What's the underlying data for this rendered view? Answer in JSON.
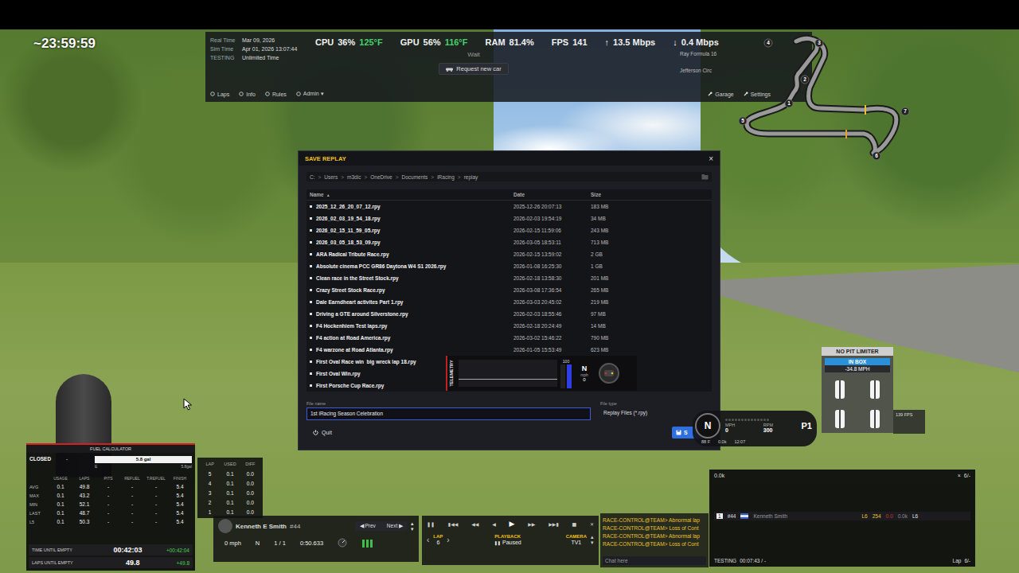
{
  "session_timer": "~23:59:59",
  "top_bar": {
    "info": [
      {
        "label": "Real Time",
        "value": "Mar 09, 2026"
      },
      {
        "label": "Sim Time",
        "value": "Apr 01, 2026 13:07:44"
      },
      {
        "label": "TESTING",
        "value": "Unlimited Time"
      }
    ],
    "stats": [
      {
        "label": "CPU",
        "value": "36%",
        "temp": "125°F"
      },
      {
        "label": "GPU",
        "value": "56%",
        "temp": "116°F"
      },
      {
        "label": "RAM",
        "value": "81.4%",
        "temp": ""
      },
      {
        "label": "FPS",
        "value": "141",
        "temp": ""
      },
      {
        "label": "↑",
        "value": "13.5 Mbps",
        "temp": ""
      },
      {
        "label": "↓",
        "value": "0.4 Mbps",
        "temp": ""
      }
    ],
    "status": "Wait",
    "request_button": "Request new car",
    "car": "Ray Formula 16",
    "track": "Jefferson Circ",
    "nav_left": [
      "Laps",
      "Info",
      "Rules",
      "Admin ▾"
    ],
    "nav_right": [
      "Garage",
      "Settings"
    ]
  },
  "track_map": {
    "turns": [
      "1",
      "2",
      "3",
      "4",
      "5",
      "6",
      "7"
    ]
  },
  "dialog": {
    "title": "SAVE REPLAY",
    "close": "×",
    "path": [
      "C:",
      "Users",
      "m3dic",
      "OneDrive",
      "Documents",
      "iRacing",
      "replay"
    ],
    "path_separator": ">",
    "columns": [
      {
        "label": "Name",
        "sort": "▲"
      },
      {
        "label": "Date",
        "sort": ""
      },
      {
        "label": "Size",
        "sort": ""
      }
    ],
    "rows": [
      {
        "name": "2025_12_26_20_07_12.rpy",
        "date": "2025-12-26 20:07:13",
        "size": "183 MB"
      },
      {
        "name": "2026_02_03_19_54_18.rpy",
        "date": "2026-02-03 19:54:19",
        "size": "34 MB"
      },
      {
        "name": "2026_02_15_11_59_05.rpy",
        "date": "2026-02-15 11:59:06",
        "size": "243 MB"
      },
      {
        "name": "2026_03_05_18_53_09.rpy",
        "date": "2026-03-05 18:53:11",
        "size": "713 MB"
      },
      {
        "name": "ARA Radical Tribute Race.rpy",
        "date": "2026-02-15 13:59:02",
        "size": "2 GB"
      },
      {
        "name": "Absolute cinema PCC GR86 Daytona W4 S1 2026.rpy",
        "date": "2026-01-08 16:25:30",
        "size": "1 GB"
      },
      {
        "name": "Clean race in the Street Stock.rpy",
        "date": "2026-02-18 13:58:30",
        "size": "201 MB"
      },
      {
        "name": "Crazy Street Stock Race.rpy",
        "date": "2026-03-08 17:36:54",
        "size": "265 MB"
      },
      {
        "name": "Dale Earndheart activites Part 1.rpy",
        "date": "2026-03-03 20:45:02",
        "size": "219 MB"
      },
      {
        "name": "Driving a GTE around Silverstone.rpy",
        "date": "2026-02-03 18:55:46",
        "size": "97 MB"
      },
      {
        "name": "F4 Hockenhiem Test laps.rpy",
        "date": "2026-02-18 20:24:49",
        "size": "14 MB"
      },
      {
        "name": "F4 action at Road America.rpy",
        "date": "2026-03-02 15:46:22",
        "size": "790 MB"
      },
      {
        "name": "F4 warzone at Road Atlanta.rpy",
        "date": "2026-01-05 15:53:49",
        "size": "623 MB"
      },
      {
        "name": "First Oval Race win  big wreck lap 18.rpy",
        "date": "",
        "size": ""
      },
      {
        "name": "First Oval Win.rpy",
        "date": "",
        "size": ""
      },
      {
        "name": "First Porsche Cup Race.rpy",
        "date": "",
        "size": ""
      }
    ],
    "file_name_label": "File name",
    "file_name": "1st iRacing Season Celebration",
    "file_type_label": "File type",
    "file_type": "Replay Files (*.rpy)",
    "quit_button": "Quit",
    "save_button": "S"
  },
  "telemetry": {
    "label": "TELEMETRY",
    "scale": "100",
    "gear": "N",
    "speed_unit": "mph",
    "speed": "0",
    "inputs": [
      {
        "name": "brake",
        "level": 0.0,
        "color": "#d03030"
      },
      {
        "name": "throttle",
        "level": 1.0,
        "color": "#2f3fe8"
      }
    ]
  },
  "dash": {
    "gear": "N",
    "speed_label": "MPH",
    "speed": "0",
    "rpm_label": "RPM",
    "rpm": "300",
    "position": "P1",
    "air_temp": "88 F",
    "gap": "0.0k",
    "clock": "12:07",
    "rpm_leds": [
      false,
      false,
      false,
      false,
      false,
      false,
      false,
      false,
      false,
      false,
      false,
      false,
      false,
      false
    ]
  },
  "pit": {
    "title": "NO PIT LIMITER",
    "status": "IN BOX",
    "speed": "-34.8 MPH",
    "tires": [
      {
        "level": 1.0
      },
      {
        "level": 1.0
      },
      {
        "level": 1.0
      },
      {
        "level": 1.0
      }
    ]
  },
  "fps_badge": "139 FPS",
  "fuel": {
    "title": "FUEL CALCULATOR",
    "status": "CLOSED",
    "status_value": "-",
    "tank": "5.8 gal",
    "tank_min": "E",
    "tank_max": "5.8gal",
    "level": 1.0,
    "columns": [
      "",
      "USAGE",
      "LAPS",
      "PITS",
      "REFUEL",
      "T.REFUEL",
      "FINISH"
    ],
    "rows": [
      [
        "AVG",
        "0.1",
        "49.8",
        "-",
        "-",
        "-",
        "5.4"
      ],
      [
        "MAX",
        "0.1",
        "43.2",
        "-",
        "-",
        "-",
        "5.4"
      ],
      [
        "MIN",
        "0.1",
        "52.1",
        "-",
        "-",
        "-",
        "5.4"
      ],
      [
        "LAST",
        "0.1",
        "48.7",
        "-",
        "-",
        "-",
        "5.4"
      ],
      [
        "L5",
        "0.1",
        "50.3",
        "-",
        "-",
        "-",
        "5.4"
      ]
    ],
    "summary": [
      {
        "label": "TIME UNTIL EMPTY",
        "value": "00:42:03",
        "delta": "+00:42:04"
      },
      {
        "label": "LAPS UNTIL EMPTY",
        "value": "49.8",
        "delta": "+49.8"
      }
    ]
  },
  "lap_usage": {
    "columns": [
      "LAP",
      "USED",
      "DIFF"
    ],
    "rows": [
      [
        "5",
        "0.1",
        "0.0"
      ],
      [
        "4",
        "0.1",
        "0.0"
      ],
      [
        "3",
        "0.1",
        "0.0"
      ],
      [
        "2",
        "0.1",
        "0.0"
      ],
      [
        "1",
        "0.1",
        "0.0"
      ]
    ]
  },
  "driver": {
    "name": "Kenneth E Smith",
    "number": "#44",
    "prev": "◀ Prev",
    "next": "Next ▶",
    "up": "▴",
    "down": "▾",
    "speed": "0 mph",
    "gear": "N",
    "position": "1 / 1",
    "last_lap": "0:50.633"
  },
  "replay": {
    "controls": [
      "❚❚",
      "▮◀◀",
      "◀◀",
      "◀",
      "▶",
      "▶▶",
      "▶▶▮",
      "■",
      "✕"
    ],
    "active_control": 4,
    "lap_label": "LAP",
    "lap": "6",
    "playback_label": "PLAYBACK",
    "playback": "Paused",
    "playback_icon": "❚❚",
    "camera_label": "CAMERA",
    "camera": "TV1",
    "left": "‹",
    "right": "›",
    "up": "▴",
    "down": "▾"
  },
  "chat": {
    "lines": [
      "RACE-CONTROL@TEAM> Abnormal lap",
      "RACE-CONTROL@TEAM> Loss of Cont",
      "RACE-CONTROL@TEAM> Abnormal lap",
      "RACE-CONTROL@TEAM> Loss of Cont"
    ],
    "placeholder": "Chat here"
  },
  "standings": {
    "header_left": "0.0k",
    "header_right": "6/-",
    "close": "×",
    "rows": [
      {
        "position": "1",
        "number": "#44",
        "name": "Kenneth Smith",
        "cells": [
          {
            "text": "L6",
            "color": "#e8c030"
          },
          {
            "text": "254",
            "color": "#e8c030"
          },
          {
            "text": "0.0",
            "color": "#d03030"
          },
          {
            "text": "0.0k",
            "color": "#8a8a8a"
          },
          {
            "text": "L6",
            "color": "#e0e0e0"
          }
        ]
      }
    ],
    "footer_left": "TESTING",
    "footer_time": "00:07:43 / -",
    "footer_lap_label": "Lap",
    "footer_lap": "6/-"
  }
}
